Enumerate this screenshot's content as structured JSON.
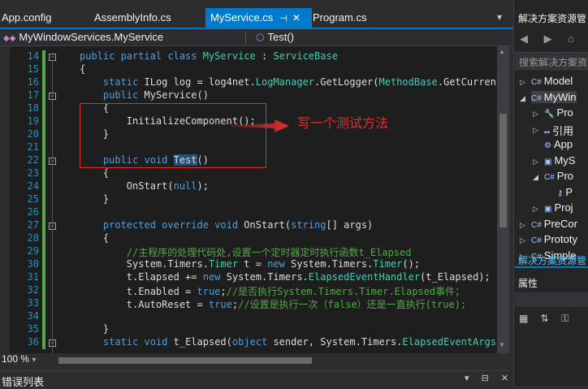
{
  "tabs": [
    {
      "label": "App.config"
    },
    {
      "label": "AssemblyInfo.cs"
    },
    {
      "label": "MyService.cs",
      "active": true,
      "pin": "⊣",
      "close": "✕"
    },
    {
      "label": "Program.cs"
    }
  ],
  "nav": {
    "type_label": "MyWindowServices.MyService",
    "member_label": "Test()"
  },
  "editor": {
    "lines": [
      {
        "num": "14",
        "html": "<span class='k'>public partial class</span> <span class='t'>MyService</span> : <span class='t'>ServiceBase</span>"
      },
      {
        "num": "15",
        "html": "{"
      },
      {
        "num": "16",
        "html": "    <span class='k'>static</span> ILog log = log4net.<span class='t'>LogManager</span>.GetLogger(<span class='t'>MethodBase</span>.GetCurrentMe"
      },
      {
        "num": "17",
        "html": "    <span class='k'>public</span> MyService()"
      },
      {
        "num": "18",
        "html": "    {"
      },
      {
        "num": "19",
        "html": "        InitializeComponent();"
      },
      {
        "num": "20",
        "html": "    }"
      },
      {
        "num": "21",
        "html": ""
      },
      {
        "num": "22",
        "html": "    <span class='k'>public void</span> <span class='hl'>Test</span>()"
      },
      {
        "num": "23",
        "html": "    {"
      },
      {
        "num": "24",
        "html": "        OnStart(<span class='k'>null</span>);"
      },
      {
        "num": "25",
        "html": "    }"
      },
      {
        "num": "26",
        "html": ""
      },
      {
        "num": "27",
        "html": "    <span class='k'>protected override void</span> OnStart(<span class='k'>string</span>[] args)"
      },
      {
        "num": "28",
        "html": "    {"
      },
      {
        "num": "29",
        "html": "        <span class='c'>//主程序的处理代码处,设置一个定时器定时执行函数t_Elapsed</span>"
      },
      {
        "num": "30",
        "html": "        System.Timers.<span class='t'>Timer</span> t = <span class='k'>new</span> System.Timers.<span class='t'>Timer</span>();"
      },
      {
        "num": "31",
        "html": "        t.Elapsed += <span class='k'>new</span> System.Timers.<span class='t'>ElapsedEventHandler</span>(t_Elapsed);"
      },
      {
        "num": "32",
        "html": "        t.Enabled = <span class='k'>true</span>;<span class='c'>//是否执行System.Timers.Timer.Elapsed事件；</span>"
      },
      {
        "num": "33",
        "html": "        t.AutoReset = <span class='k'>true</span>;<span class='c'>//设置是执行一次（false）还是一直执行(true);</span>"
      },
      {
        "num": "34",
        "html": ""
      },
      {
        "num": "35",
        "html": "    }"
      },
      {
        "num": "36",
        "html": "    <span class='k'>static void</span> t_Elapsed(<span class='k'>object</span> sender, System.Timers.<span class='t'>ElapsedEventArgs</span> e)"
      }
    ],
    "annotation": "写一个测试方法"
  },
  "status": {
    "zoom": "100 %",
    "zoom_caret": "▾"
  },
  "bottom_panel": {
    "title": "错误列表",
    "icons": "▾ ⊟ ✕"
  },
  "solution_explorer": {
    "title": "解决方案资源管",
    "toolbar_icons": "◀ ▶ ⌂",
    "search_placeholder": "搜索解决方案资源管",
    "items": [
      {
        "label": "Model",
        "icon": "C#",
        "indent": 1,
        "tri": "▷"
      },
      {
        "label": "MyWin",
        "icon": "C#",
        "indent": 1,
        "tri": "◢",
        "selected": true
      },
      {
        "label": "Pro",
        "icon": "🔧",
        "indent": 2,
        "tri": "▷"
      },
      {
        "label": "引用",
        "icon": "▪▪",
        "indent": 2,
        "tri": "▷"
      },
      {
        "label": "App",
        "icon": "⚙",
        "indent": 2,
        "tri": ""
      },
      {
        "label": "MyS",
        "icon": "▣",
        "indent": 2,
        "tri": "▷"
      },
      {
        "label": "Pro",
        "icon": "C#",
        "indent": 2,
        "tri": "◢"
      },
      {
        "label": "P",
        "icon": "⚷",
        "indent": 3,
        "tri": ""
      },
      {
        "label": "Proj",
        "icon": "▣",
        "indent": 2,
        "tri": "▷"
      },
      {
        "label": "PreCor",
        "icon": "C#",
        "indent": 1,
        "tri": "▷"
      },
      {
        "label": "Prototy",
        "icon": "C#",
        "indent": 1,
        "tri": "▷"
      },
      {
        "label": "Simple",
        "icon": "C#",
        "indent": 1,
        "tri": "▷"
      }
    ],
    "bottom_tab": "解决方案资源管"
  },
  "properties": {
    "title": "属性",
    "icons": "▦ ⇅ ⚿"
  },
  "colors": {
    "accent": "#007acc",
    "annotation": "#e03030",
    "keyword": "#569cd6",
    "type": "#4ec9b0",
    "comment": "#57a64a"
  }
}
